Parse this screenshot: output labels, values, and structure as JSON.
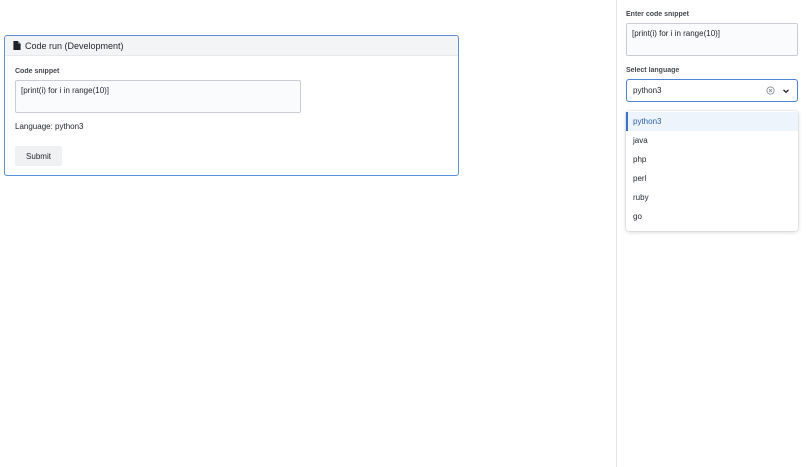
{
  "main": {
    "card": {
      "title": "Code run (Development)",
      "snippet_label": "Code snippet",
      "snippet_value": "[print(i) for i in range(10)]",
      "language_line": "Language: python3",
      "submit_label": "Submit"
    }
  },
  "right_panel": {
    "snippet_label": "Enter code snippet",
    "snippet_value": "[print(i) for i in range(10)]",
    "language_label": "Select language",
    "language_selected": "python3",
    "language_options": [
      "python3",
      "java",
      "php",
      "perl",
      "ruby",
      "go"
    ]
  },
  "colors": {
    "accent": "#4a86d4",
    "selected_option_bg": "#eef4fc"
  }
}
